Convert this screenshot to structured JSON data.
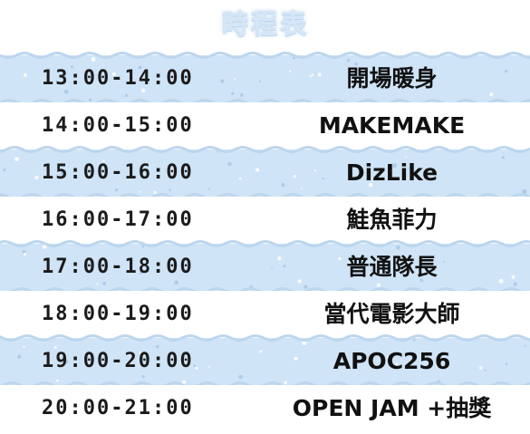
{
  "title": "時程表",
  "schedule": [
    {
      "time": "13:00-14:00",
      "act": "開場暖身"
    },
    {
      "time": "14:00-15:00",
      "act": "MAKEMAKE"
    },
    {
      "time": "15:00-16:00",
      "act": "DizLike"
    },
    {
      "time": "16:00-17:00",
      "act": "鮭魚菲力"
    },
    {
      "time": "17:00-18:00",
      "act": "普通隊長"
    },
    {
      "time": "18:00-19:00",
      "act": "當代電影大師"
    },
    {
      "time": "19:00-20:00",
      "act": "APOC256"
    },
    {
      "time": "20:00-21:00",
      "act": "OPEN JAM +抽獎"
    }
  ],
  "colors": {
    "band_blue": "#cfe4f6",
    "band_white": "#ffffff",
    "text": "#111111",
    "title": "#d4e6f7"
  }
}
